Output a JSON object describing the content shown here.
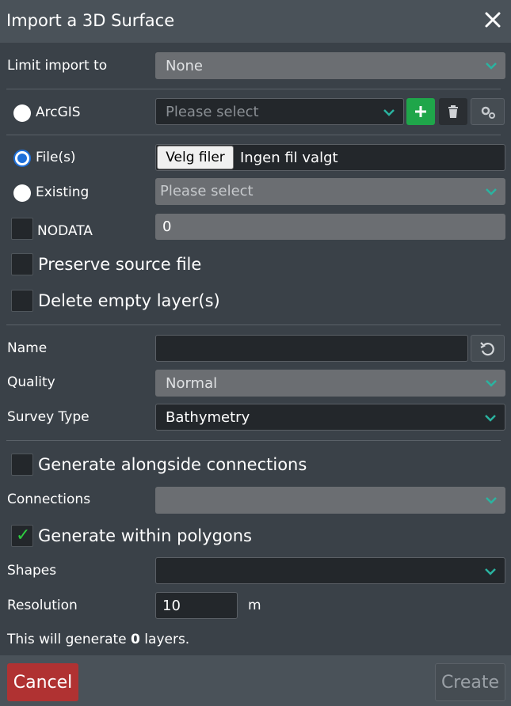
{
  "dialog": {
    "title": "Import a 3D Surface"
  },
  "limit_import": {
    "label": "Limit import to",
    "value": "None"
  },
  "arcgis": {
    "label": "ArcGIS",
    "placeholder": "Please select"
  },
  "files": {
    "label": "File(s)",
    "button_label": "Velg filer",
    "status": "Ingen fil valgt"
  },
  "existing": {
    "label": "Existing",
    "placeholder": "Please select"
  },
  "nodata": {
    "label": "NODATA",
    "value": "0"
  },
  "preserve": {
    "label": "Preserve source file"
  },
  "delete_empty": {
    "label": "Delete empty layer(s)"
  },
  "name": {
    "label": "Name",
    "value": ""
  },
  "quality": {
    "label": "Quality",
    "value": "Normal"
  },
  "survey_type": {
    "label": "Survey Type",
    "value": "Bathymetry"
  },
  "alongside": {
    "label": "Generate alongside connections"
  },
  "connections": {
    "label": "Connections",
    "value": ""
  },
  "within_polygons": {
    "label": "Generate within polygons",
    "check": "✓"
  },
  "shapes": {
    "label": "Shapes",
    "value": ""
  },
  "resolution": {
    "label": "Resolution",
    "value": "10",
    "unit": "m"
  },
  "summary": {
    "prefix": "This will generate",
    "count": "0",
    "suffix": "layers."
  },
  "footer": {
    "cancel_label": "Cancel",
    "create_label": "Create"
  },
  "colors": {
    "accent_green": "#1fa64a",
    "danger_red": "#b03232",
    "radio_blue": "#1e6fd9",
    "check_green": "#2ecc40"
  }
}
